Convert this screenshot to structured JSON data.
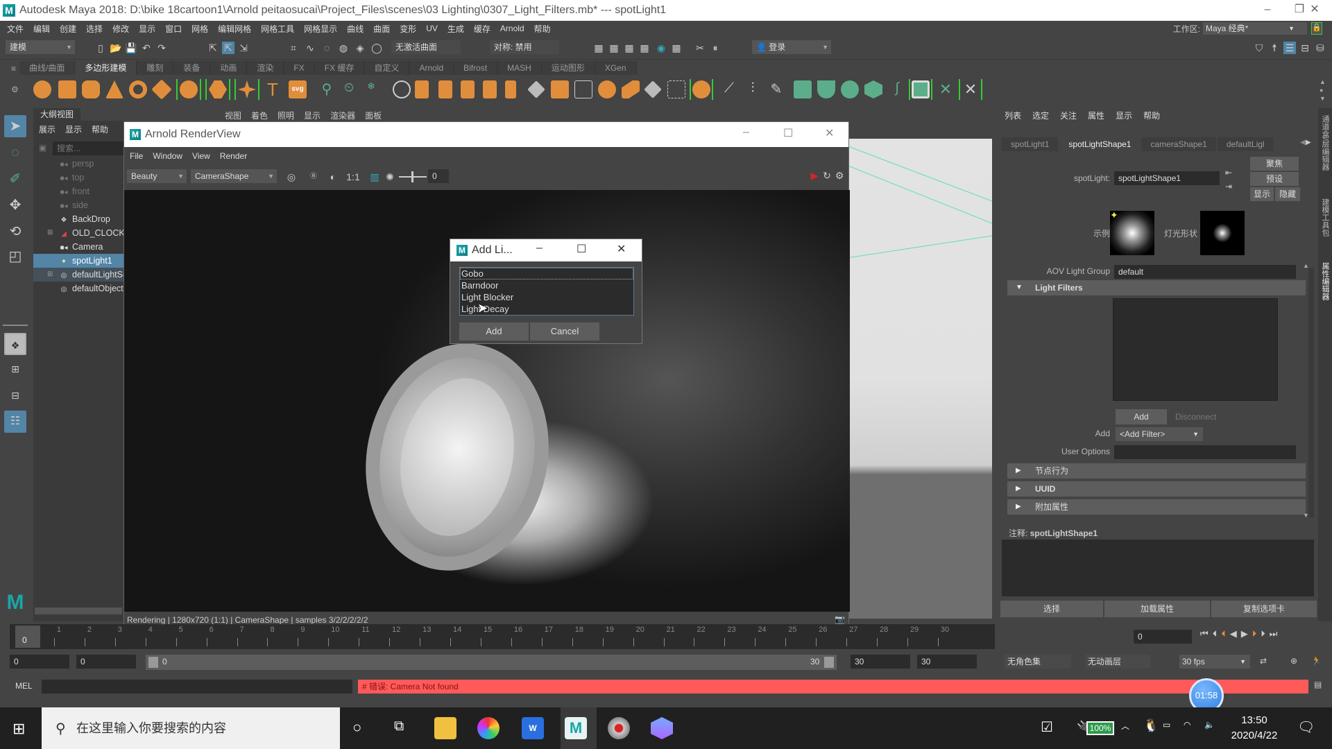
{
  "window": {
    "title": "Autodesk Maya 2018: D:\\bike 18cartoon1\\Arnold peitaosucai\\Project_Files\\scenes\\03 Lighting\\0307_Light_Filters.mb*  ---  spotLight1",
    "minimize": "–",
    "restore": "❐",
    "close": "✕"
  },
  "menubar": {
    "items": [
      "文件",
      "编辑",
      "创建",
      "选择",
      "修改",
      "显示",
      "窗口",
      "网格",
      "编辑网格",
      "网格工具",
      "网格显示",
      "曲线",
      "曲面",
      "变形",
      "UV",
      "生成",
      "缓存",
      "Arnold",
      "帮助"
    ],
    "workspace_label": "工作区:",
    "workspace_value": "Maya 经典*"
  },
  "statusline": {
    "mode": "建模",
    "live_surface": "无激活曲面",
    "symmetry": "对称: 禁用",
    "login": "登录"
  },
  "shelf": {
    "tabs": [
      "曲线/曲面",
      "多边形建模",
      "雕刻",
      "装备",
      "动画",
      "渲染",
      "FX",
      "FX 缓存",
      "自定义",
      "Arnold",
      "Bifrost",
      "MASH",
      "运动图形",
      "XGen"
    ],
    "active_tab": "多边形建模"
  },
  "panel_menu": [
    "视图",
    "着色",
    "照明",
    "显示",
    "渲染器",
    "面板"
  ],
  "outliner": {
    "title": "大纲视图",
    "menu": [
      "展示",
      "显示",
      "帮助"
    ],
    "search_placeholder": "搜索...",
    "items": [
      {
        "label": "persp",
        "icon": "camera",
        "dim": true
      },
      {
        "label": "top",
        "icon": "camera",
        "dim": true
      },
      {
        "label": "front",
        "icon": "camera",
        "dim": true
      },
      {
        "label": "side",
        "icon": "camera",
        "dim": true
      },
      {
        "label": "BackDrop",
        "icon": "mesh",
        "dim": false
      },
      {
        "label": "OLD_CLOCK",
        "icon": "group",
        "dim": false,
        "expandable": true
      },
      {
        "label": "Camera",
        "icon": "camera",
        "dim": false
      },
      {
        "label": "spotLight1",
        "icon": "spotlight",
        "dim": false,
        "selected": true
      },
      {
        "label": "defaultLightSet",
        "icon": "set",
        "dim": false,
        "expandable": true
      },
      {
        "label": "defaultObjectSet",
        "icon": "set",
        "dim": false
      }
    ]
  },
  "renderview": {
    "title": "Arnold RenderView",
    "menu": [
      "File",
      "Window",
      "View",
      "Render"
    ],
    "aov": "Beauty",
    "camera": "CameraShape",
    "ratio": "1:1",
    "exposure": "0",
    "status": "Rendering | 1280x720 (1:1) | CameraShape  | samples 3/2/2/2/2/2"
  },
  "dialog": {
    "title": "Add Li...",
    "items": [
      "Gobo",
      "Barndoor",
      "Light Blocker",
      "Light Decay"
    ],
    "focused_item": "Gobo",
    "add_label": "Add",
    "cancel_label": "Cancel"
  },
  "attribute_editor": {
    "menu": [
      "列表",
      "选定",
      "关注",
      "属性",
      "显示",
      "帮助"
    ],
    "tabs": [
      "spotLight1",
      "spotLightShape1",
      "cameraShape1",
      "defaultLigl"
    ],
    "active_tab": "spotLightShape1",
    "node_type_label": "spotLight:",
    "node_name": "spotLightShape1",
    "buttons": {
      "focus": "聚焦",
      "presets": "预设",
      "show": "显示",
      "hide": "隐藏"
    },
    "sample_label": "示例",
    "light_shape_label": "灯光形状",
    "aov_label": "AOV Light Group",
    "aov_value": "default",
    "light_filters_section": "Light Filters",
    "add_button": "Add",
    "disconnect_button": "Disconnect",
    "add_filter_label": "Add",
    "add_filter_value": "<Add Filter>",
    "user_options_label": "User Options",
    "user_options_value": "",
    "collapsed_sections": [
      "节点行为",
      "UUID",
      "附加属性"
    ],
    "notes_label": "注释:",
    "notes_node": "spotLightShape1",
    "bottom_buttons": [
      "选择",
      "加载属性",
      "复制选项卡"
    ]
  },
  "side_tabs": [
    "通道盒/层编辑器",
    "建模工具包",
    "属性编辑器"
  ],
  "timeline": {
    "ticks": [
      "0",
      "1",
      "2",
      "3",
      "4",
      "5",
      "6",
      "7",
      "8",
      "9",
      "10",
      "11",
      "12",
      "13",
      "14",
      "15",
      "16",
      "17",
      "18",
      "19",
      "20",
      "21",
      "22",
      "23",
      "24",
      "25",
      "26",
      "27",
      "28",
      "29",
      "30"
    ],
    "current_frame": "0",
    "current_frame_field": "0"
  },
  "range": {
    "start": "0",
    "anim_start": "0",
    "slider_start": "0",
    "slider_end": "30",
    "anim_end": "30",
    "end": "30",
    "character_set": "无角色集",
    "anim_layer": "无动画层",
    "fps": "30 fps"
  },
  "command_line": {
    "lang": "MEL",
    "input": "",
    "error": "# 错误: Camera Not found",
    "error_color": "#ff5a5a"
  },
  "recorder_timer": "01:58",
  "taskbar": {
    "search_placeholder": "在这里输入你要搜索的内容",
    "battery": "100%",
    "time": "13:50",
    "date": "2020/4/22"
  }
}
